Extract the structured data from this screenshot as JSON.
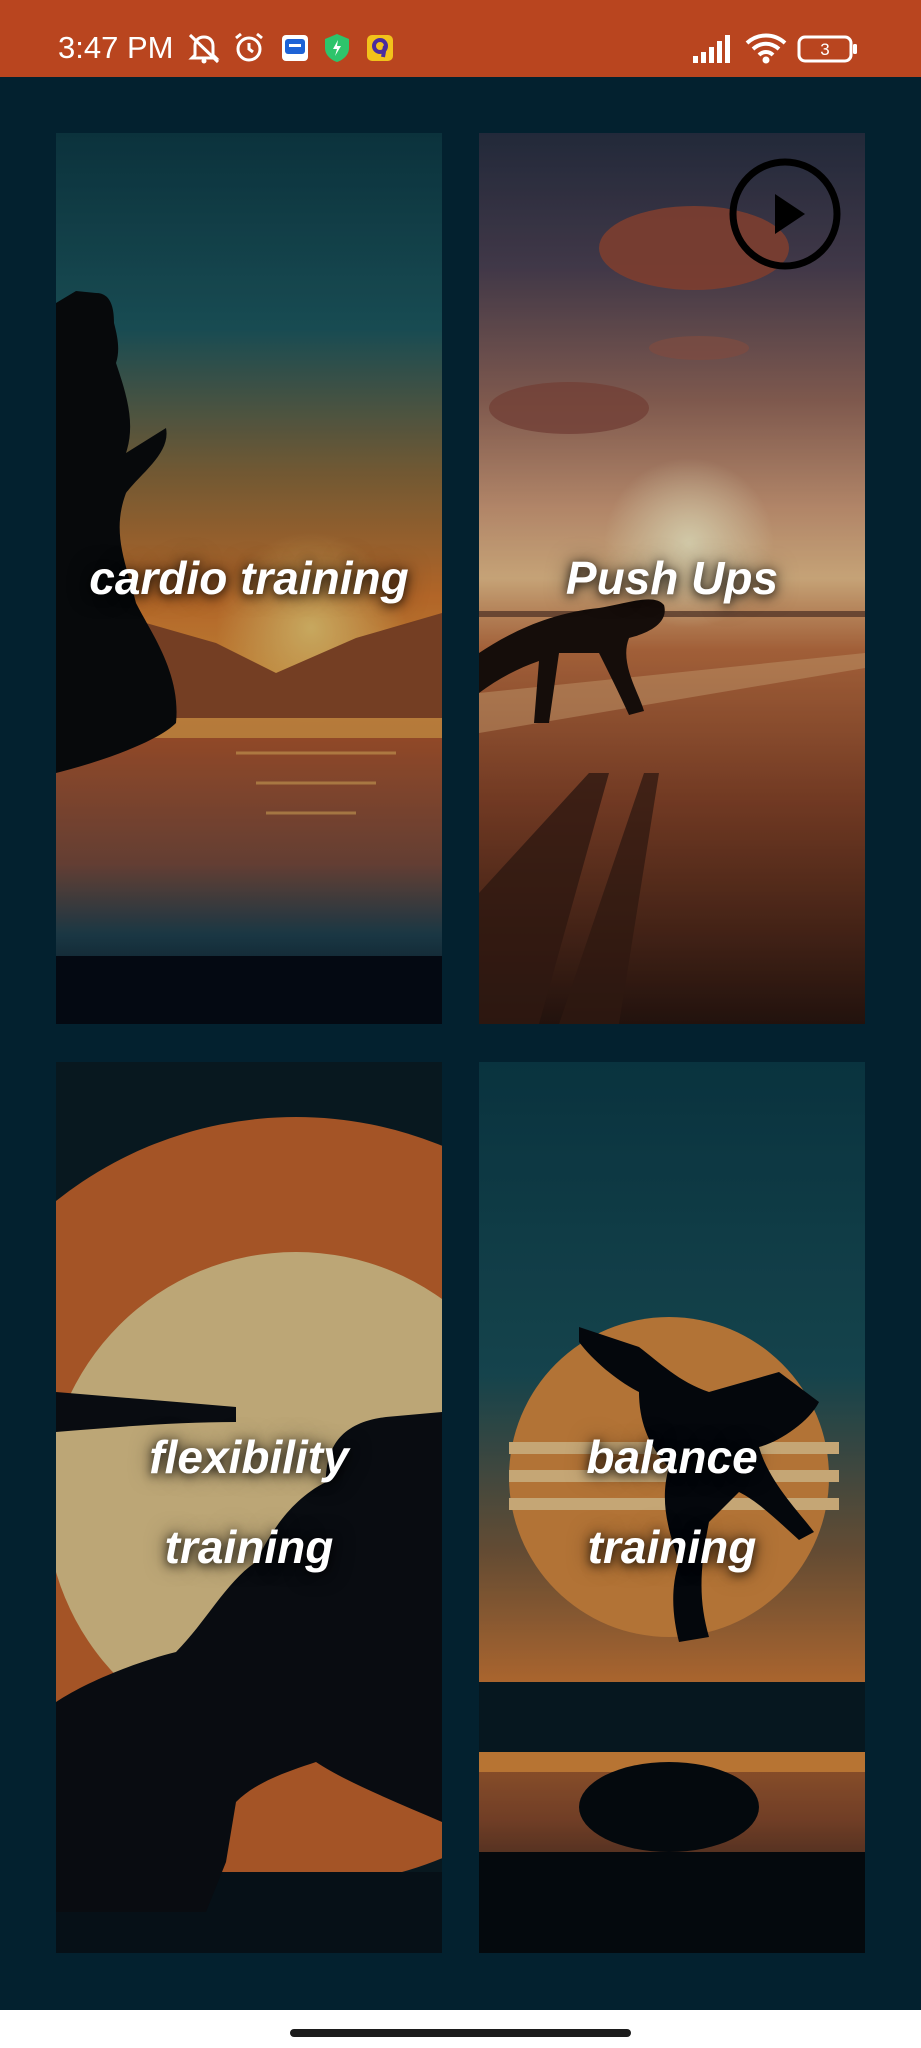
{
  "status_bar": {
    "time": "3:47 PM",
    "battery_level": "3",
    "icons": [
      "mute-bell-icon",
      "alarm-icon",
      "messenger-app-icon",
      "shield-app-icon",
      "yellow-app-icon",
      "signal-icon",
      "wifi-icon",
      "battery-icon"
    ]
  },
  "cards": [
    {
      "label": "cardio training",
      "theme": "runner at sunset over lake"
    },
    {
      "label": "Push Ups",
      "theme": "push ups on beach at sunset"
    },
    {
      "label": "flexibility training",
      "theme": "stretching silhouette before sun"
    },
    {
      "label": "balance training",
      "theme": "balance pose on rock before sun"
    }
  ],
  "video_control": {
    "icon": "play-icon"
  },
  "colors": {
    "status_bar": "#b9451f",
    "background": "#03212f",
    "label_text": "#ffffff",
    "sunset_orange": "#d9722a"
  }
}
